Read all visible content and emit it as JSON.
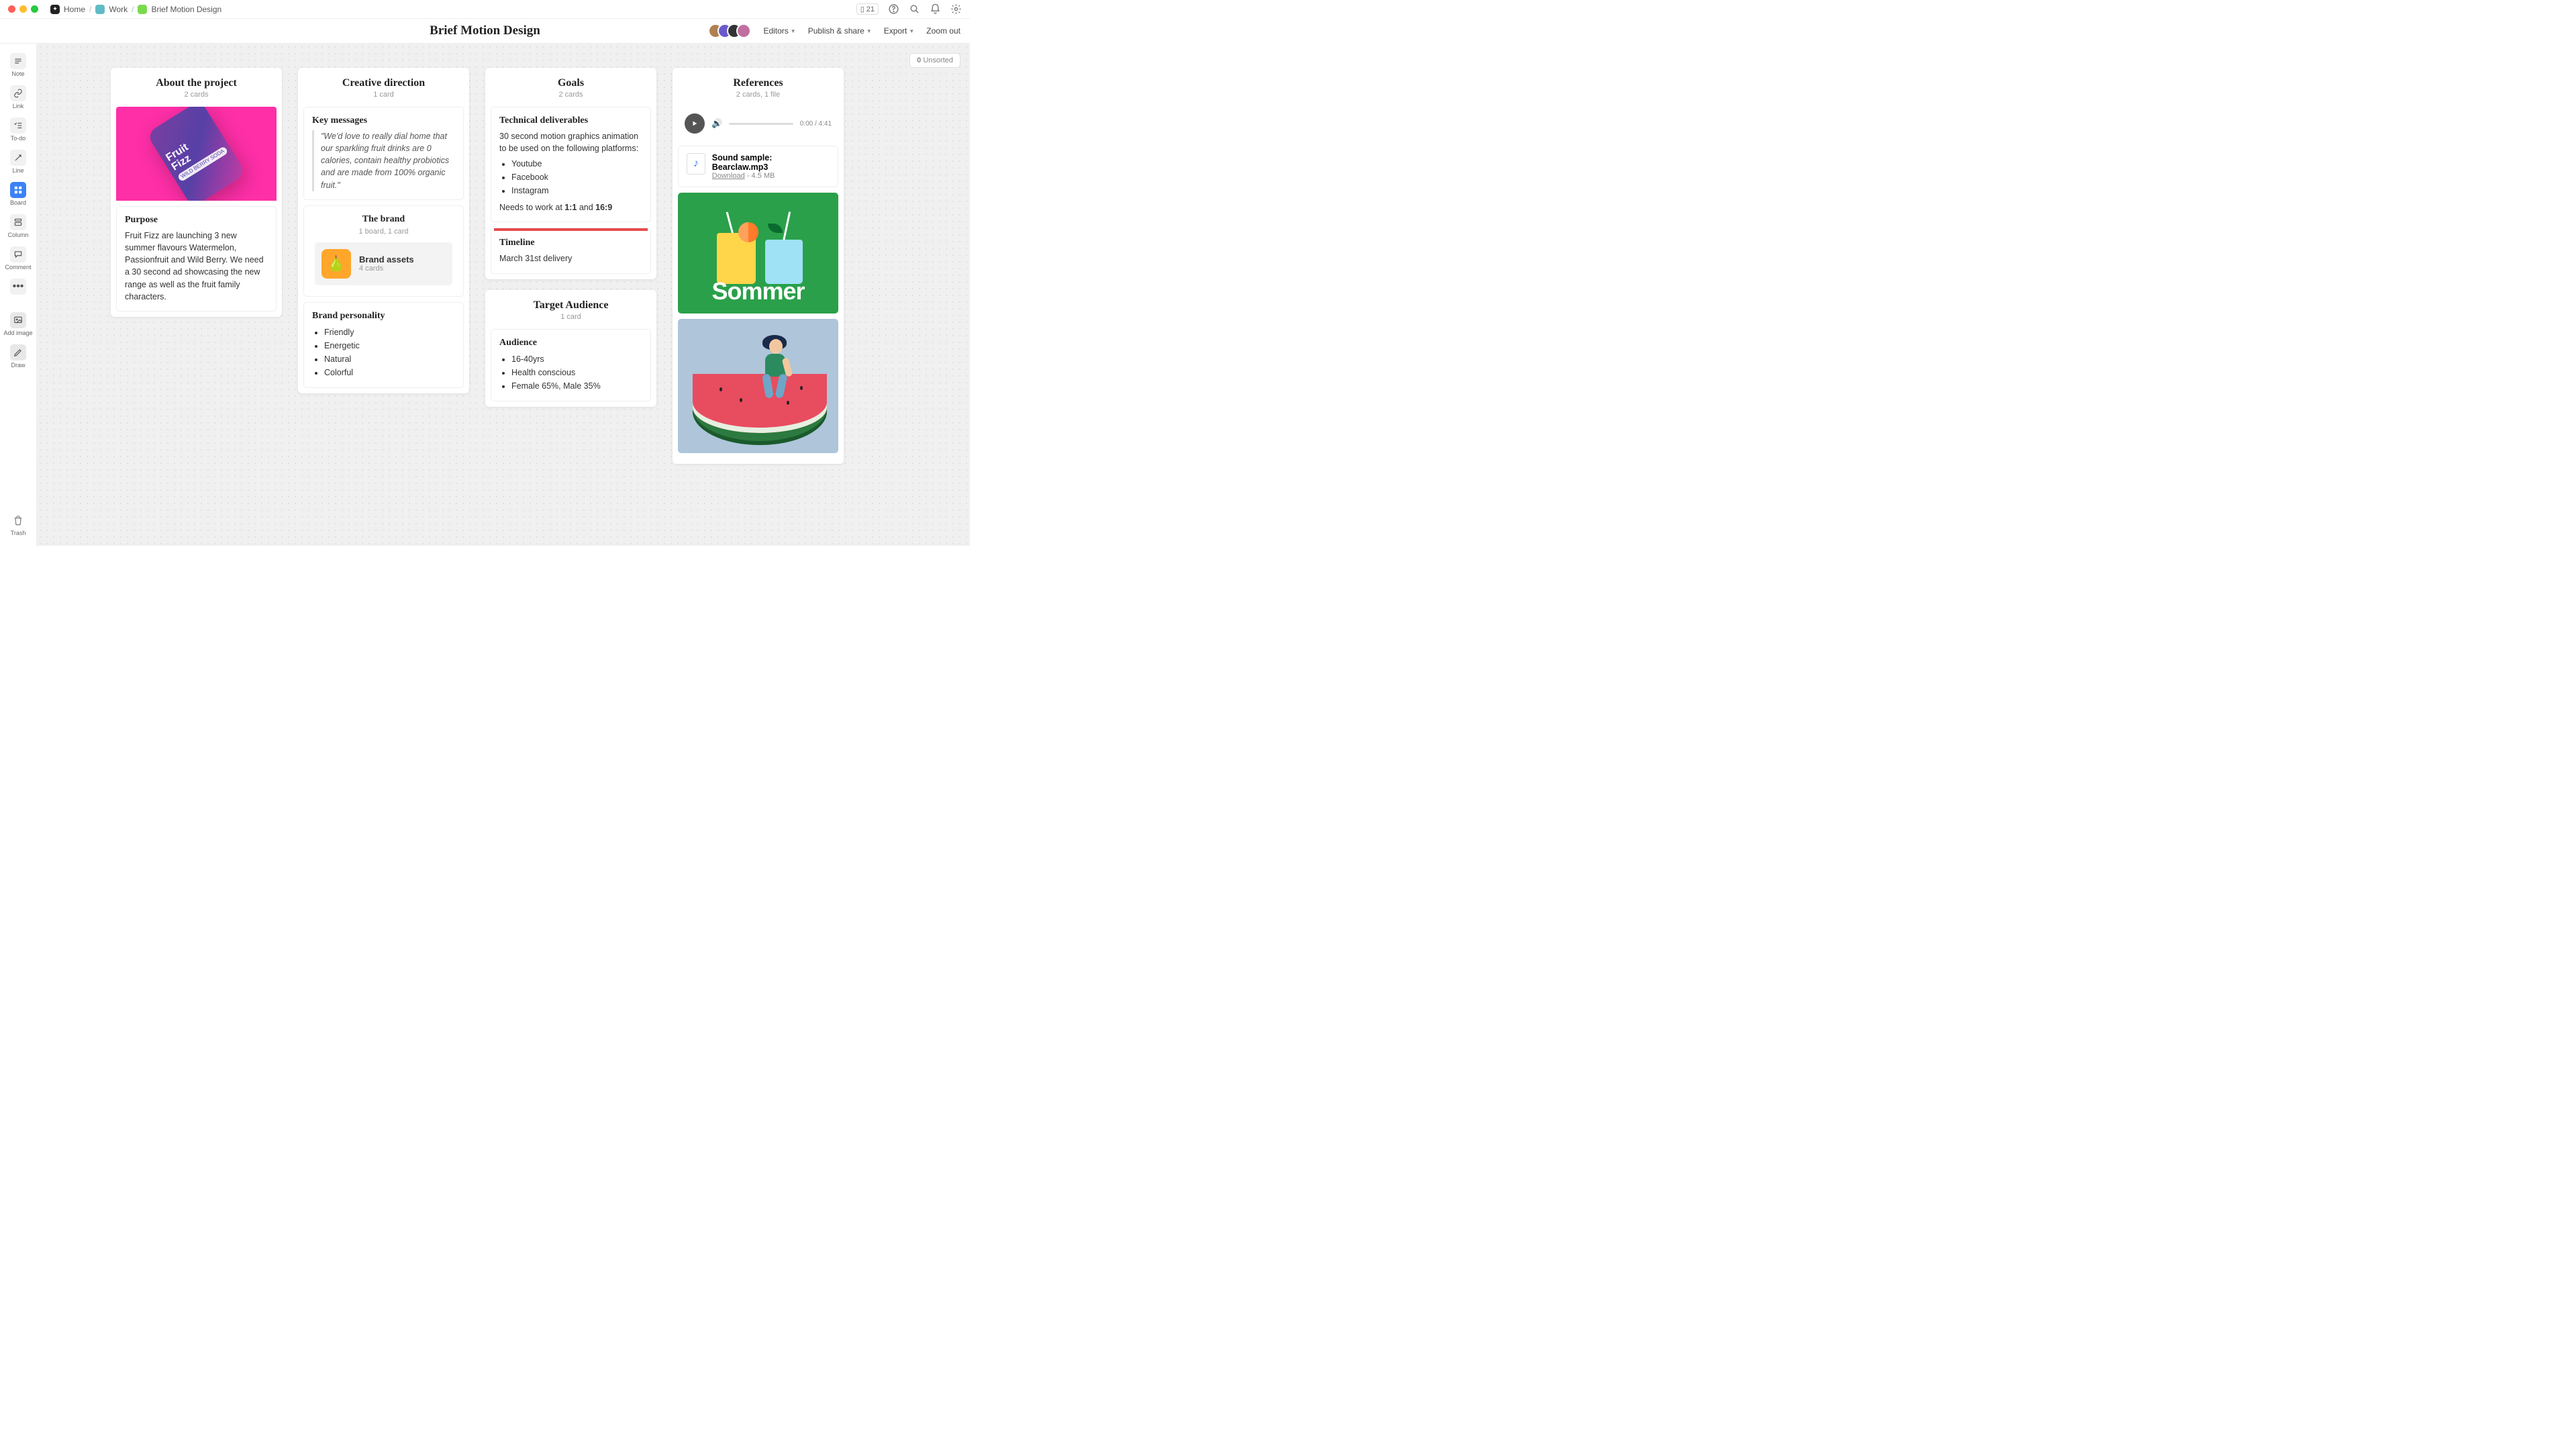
{
  "app": {
    "breadcrumbs": [
      {
        "label": "Home",
        "icon_bg": "#222",
        "icon_fg": "#fff"
      },
      {
        "label": "Work",
        "icon_bg": "#5fbcc4",
        "icon_fg": "#fff"
      },
      {
        "label": "Brief Motion Design",
        "icon_bg": "#7bd94e",
        "icon_fg": "#fff"
      }
    ],
    "notif_count": "21"
  },
  "header": {
    "title": "Brief Motion Design",
    "editors_label": "Editors",
    "publish_label": "Publish & share",
    "export_label": "Export",
    "zoom_label": "Zoom out"
  },
  "sidebar": {
    "tools": [
      {
        "id": "note",
        "label": "Note",
        "glyph": "≡"
      },
      {
        "id": "link",
        "label": "Link",
        "glyph": "🔗"
      },
      {
        "id": "todo",
        "label": "To-do",
        "glyph": "☑"
      },
      {
        "id": "line",
        "label": "Line",
        "glyph": "↗"
      },
      {
        "id": "board",
        "label": "Board",
        "glyph": "⊞",
        "active": true
      },
      {
        "id": "column",
        "label": "Column",
        "glyph": "▭"
      },
      {
        "id": "comment",
        "label": "Comment",
        "glyph": "💬"
      },
      {
        "id": "more",
        "label": "",
        "glyph": "…"
      }
    ],
    "add_image_label": "Add image",
    "draw_label": "Draw",
    "trash_label": "Trash"
  },
  "canvas": {
    "unsorted_count": "0",
    "unsorted_label": "Unsorted"
  },
  "columns": {
    "about": {
      "title": "About the project",
      "sub": "2 cards",
      "can_brand": "Fruit\nFizz",
      "can_flavour": "WILD BERRY SODA",
      "purpose_title": "Purpose",
      "purpose_body": "Fruit Fizz are launching 3 new summer flavours Watermelon, Passionfruit and Wild Berry. We need a 30 second ad showcasing the new range as well as the fruit family characters."
    },
    "creative": {
      "title": "Creative direction",
      "sub": "1 card",
      "key_title": "Key messages",
      "key_quote": "\"We'd love to really dial home that our sparkling fruit drinks are 0 calories, contain healthy probiotics and are made from 100% organic fruit.\"",
      "brand_title": "The brand",
      "brand_sub": "1 board, 1 card",
      "asset_name": "Brand assets",
      "asset_sub": "4 cards",
      "personality_title": "Brand personality",
      "personality_items": [
        "Friendly",
        "Energetic",
        "Natural",
        "Colorful"
      ]
    },
    "goals": {
      "title": "Goals",
      "sub": "2 cards",
      "tech_title": "Technical deliverables",
      "tech_body": "30 second motion graphics animation to be used on the following platforms:",
      "tech_items": [
        "Youtube",
        "Facebook",
        "Instagram"
      ],
      "tech_needs_prefix": "Needs to work at ",
      "tech_ratio1": "1:1",
      "tech_and": " and ",
      "tech_ratio2": "16:9",
      "timeline_title": "Timeline",
      "timeline_body": "March 31st delivery",
      "audience_col_title": "Target Audience",
      "audience_col_sub": "1 card",
      "audience_title": "Audience",
      "audience_items": [
        "16-40yrs",
        "Health conscious",
        "Female 65%, Male 35%"
      ]
    },
    "refs": {
      "title": "References",
      "sub": "2 cards, 1 file",
      "audio_time": "0:00 / 4:41",
      "file_name": "Sound sample: Bearclaw.mp3",
      "file_download": "Download",
      "file_size": " - 4.5 MB",
      "sommer_text": "Sommer"
    }
  }
}
